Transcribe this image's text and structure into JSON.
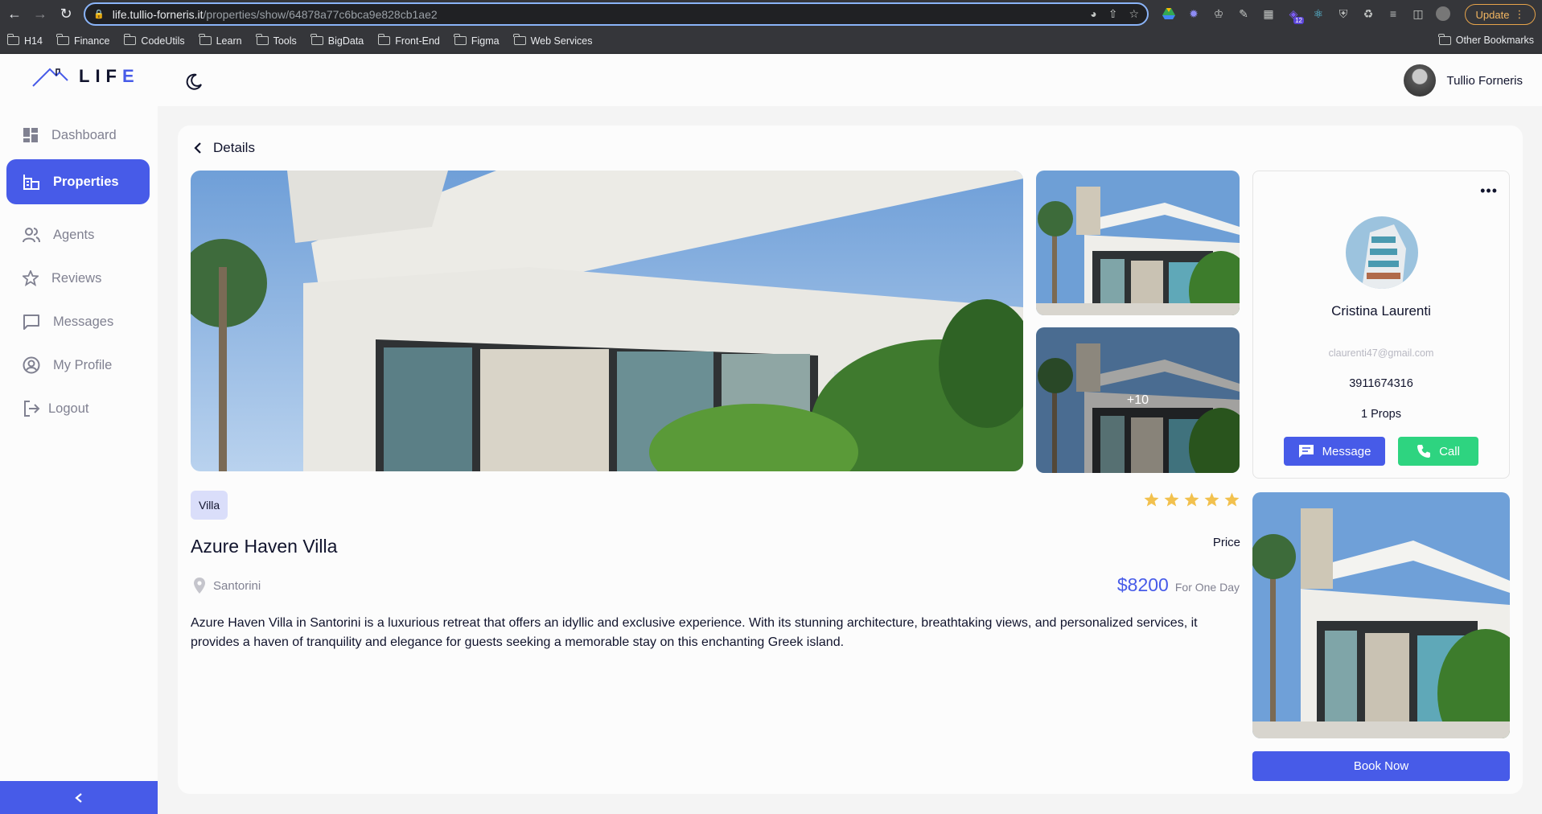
{
  "browser": {
    "url_host": "life.tullio-forneris.it",
    "url_path": "/properties/show/64878a77c6bca9e828cb1ae2",
    "update_label": "Update",
    "ext_badge": "12",
    "bookmarks": [
      "H14",
      "Finance",
      "CodeUtils",
      "Learn",
      "Tools",
      "BigData",
      "Front-End",
      "Figma",
      "Web Services"
    ],
    "other_bookmarks": "Other Bookmarks"
  },
  "app": {
    "logo_text_main": "LIF",
    "logo_text_accent": "E",
    "user_name": "Tullio Forneris"
  },
  "sidebar": {
    "items": [
      {
        "label": "Dashboard",
        "icon": "dashboard-icon"
      },
      {
        "label": "Properties",
        "icon": "properties-icon",
        "active": true
      },
      {
        "label": "Agents",
        "icon": "agents-icon"
      },
      {
        "label": "Reviews",
        "icon": "star-outline-icon"
      },
      {
        "label": "Messages",
        "icon": "chat-icon"
      },
      {
        "label": "My Profile",
        "icon": "profile-icon"
      },
      {
        "label": "Logout",
        "icon": "logout-icon"
      }
    ]
  },
  "details": {
    "header": "Details",
    "more_photos": "+10",
    "type_tag": "Villa",
    "rating": 5,
    "title": "Azure Haven Villa",
    "price_label": "Price",
    "location": "Santorini",
    "price_value": "$8200",
    "price_unit": "For One Day",
    "description": "Azure Haven Villa in Santorini is a luxurious retreat that offers an idyllic and exclusive experience. With its stunning architecture, breathtaking views, and personalized services, it provides a haven of tranquility and elegance for guests seeking a memorable stay on this enchanting Greek island.",
    "book_label": "Book Now"
  },
  "agent": {
    "name": "Cristina Laurenti",
    "email": "claurenti47@gmail.com",
    "phone": "3911674316",
    "props": "1 Props",
    "message_label": "Message",
    "call_label": "Call"
  },
  "colors": {
    "primary": "#475be8",
    "success": "#2ed480",
    "star": "#f2c14e"
  }
}
